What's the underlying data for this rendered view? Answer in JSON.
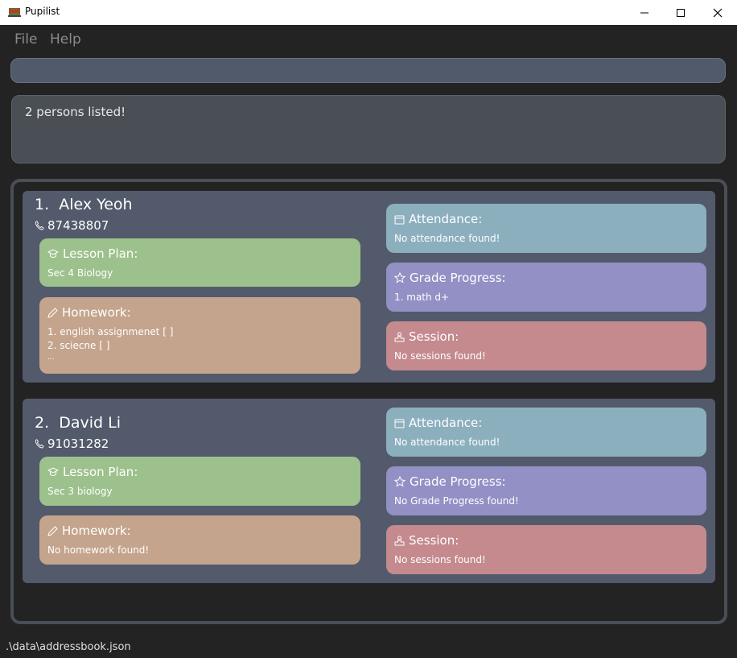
{
  "window": {
    "title": "Pupilist"
  },
  "menu": {
    "file": "File",
    "help": "Help"
  },
  "command_box": {
    "value": ""
  },
  "result": {
    "text": "2 persons listed!"
  },
  "persons": [
    {
      "index": "1.",
      "name": "Alex Yeoh",
      "phone": "87438807",
      "lesson_plan": {
        "label": "Lesson Plan:",
        "value": "Sec 4 Biology"
      },
      "homework": {
        "label": "Homework:",
        "lines": [
          "1. english assignmenet [ ]",
          "2. sciecne [ ]",
          "..."
        ]
      },
      "attendance": {
        "label": "Attendance:",
        "value": "No attendance found!"
      },
      "grade_progress": {
        "label": "Grade Progress:",
        "value": "1. math d+"
      },
      "session": {
        "label": "Session:",
        "value": "No sessions found!"
      }
    },
    {
      "index": "2.",
      "name": "David Li",
      "phone": "91031282",
      "lesson_plan": {
        "label": "Lesson Plan:",
        "value": "Sec 3 biology"
      },
      "homework": {
        "label": "Homework:",
        "lines": [
          "No homework found!"
        ]
      },
      "attendance": {
        "label": "Attendance:",
        "value": "No attendance found!"
      },
      "grade_progress": {
        "label": "Grade Progress:",
        "value": "No Grade Progress found!"
      },
      "session": {
        "label": "Session:",
        "value": "No sessions found!"
      }
    }
  ],
  "status": {
    "file_path": ".\\data\\addressbook.json"
  },
  "icons": {
    "app": "app-book-icon",
    "phone": "phone-icon",
    "lesson": "graduation-cap-icon",
    "homework": "pencil-icon",
    "attendance": "calendar-icon",
    "grade": "star-icon",
    "session": "podium-icon"
  }
}
